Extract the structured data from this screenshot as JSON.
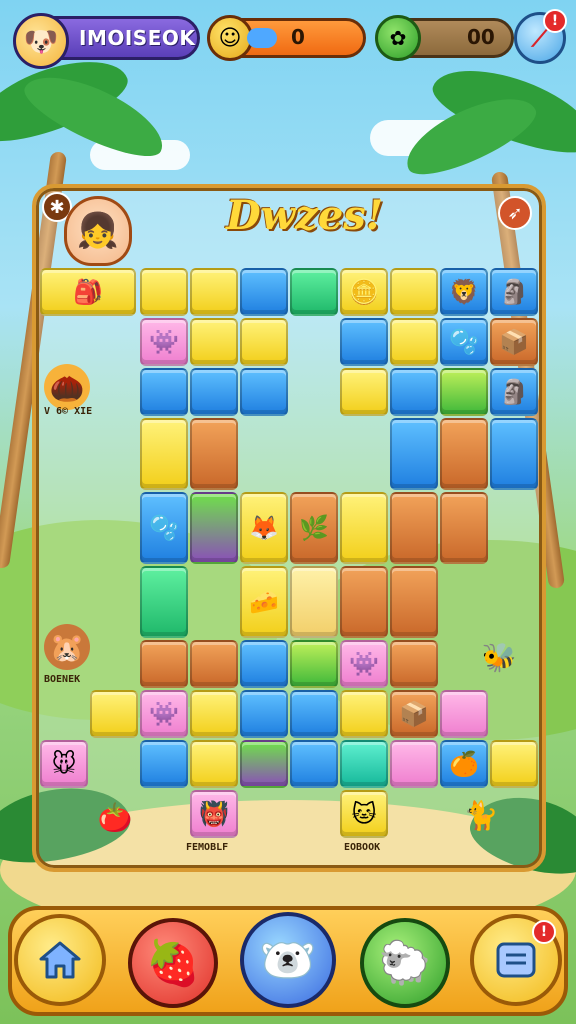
{
  "hud": {
    "player_name": "IMOISEOK",
    "coin_value": "0",
    "gem_value": "00",
    "settings_badge": "!"
  },
  "board": {
    "title": "Dwzes!",
    "close_glyph": "✱",
    "action_glyph": "➶"
  },
  "side_characters": [
    {
      "label": "V 6© XIE"
    },
    {
      "label": "BOENEK"
    },
    {
      "label": "FEMOBLF"
    },
    {
      "label": "EOBOOK"
    }
  ],
  "colors": {
    "board_border": "#d99a32",
    "title_text": "#ffd93a",
    "profile_pill": "#5a3fb8",
    "coin_pill": "#f06a12",
    "gem_pill": "#8c6a3c",
    "bottom_bar": "#f0a21a"
  },
  "nav": {
    "home_icon": "home-icon",
    "red_creature_icon": "red-creature-icon",
    "blue_creature_icon": "blue-creature-icon",
    "green_creature_icon": "green-creature-icon",
    "menu_icon": "menu-icon",
    "menu_badge": "!"
  }
}
